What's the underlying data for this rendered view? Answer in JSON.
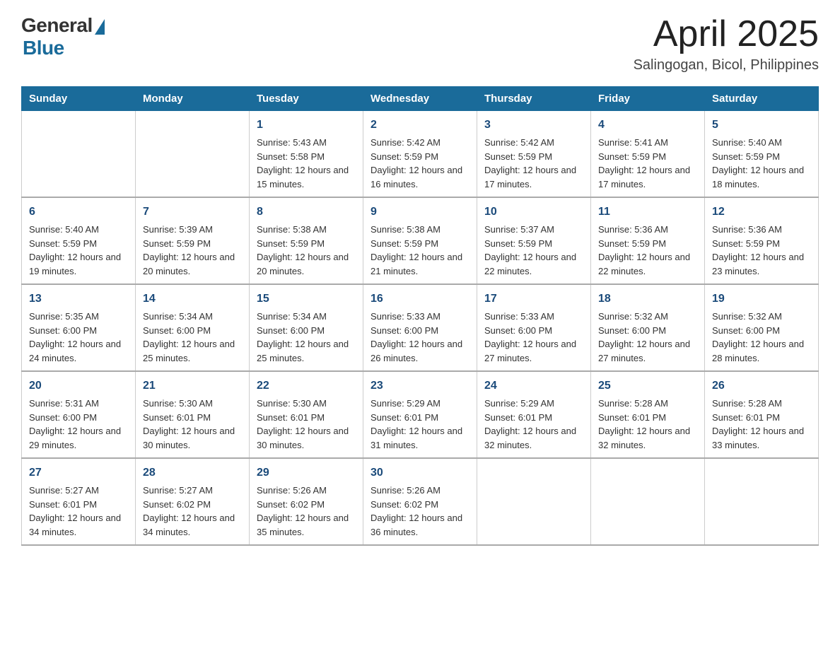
{
  "header": {
    "logo": {
      "general": "General",
      "blue": "Blue"
    },
    "title": "April 2025",
    "subtitle": "Salingogan, Bicol, Philippines"
  },
  "days_of_week": [
    "Sunday",
    "Monday",
    "Tuesday",
    "Wednesday",
    "Thursday",
    "Friday",
    "Saturday"
  ],
  "weeks": [
    [
      {
        "day": "",
        "info": ""
      },
      {
        "day": "",
        "info": ""
      },
      {
        "day": "1",
        "info": "Sunrise: 5:43 AM\nSunset: 5:58 PM\nDaylight: 12 hours and 15 minutes."
      },
      {
        "day": "2",
        "info": "Sunrise: 5:42 AM\nSunset: 5:59 PM\nDaylight: 12 hours and 16 minutes."
      },
      {
        "day": "3",
        "info": "Sunrise: 5:42 AM\nSunset: 5:59 PM\nDaylight: 12 hours and 17 minutes."
      },
      {
        "day": "4",
        "info": "Sunrise: 5:41 AM\nSunset: 5:59 PM\nDaylight: 12 hours and 17 minutes."
      },
      {
        "day": "5",
        "info": "Sunrise: 5:40 AM\nSunset: 5:59 PM\nDaylight: 12 hours and 18 minutes."
      }
    ],
    [
      {
        "day": "6",
        "info": "Sunrise: 5:40 AM\nSunset: 5:59 PM\nDaylight: 12 hours and 19 minutes."
      },
      {
        "day": "7",
        "info": "Sunrise: 5:39 AM\nSunset: 5:59 PM\nDaylight: 12 hours and 20 minutes."
      },
      {
        "day": "8",
        "info": "Sunrise: 5:38 AM\nSunset: 5:59 PM\nDaylight: 12 hours and 20 minutes."
      },
      {
        "day": "9",
        "info": "Sunrise: 5:38 AM\nSunset: 5:59 PM\nDaylight: 12 hours and 21 minutes."
      },
      {
        "day": "10",
        "info": "Sunrise: 5:37 AM\nSunset: 5:59 PM\nDaylight: 12 hours and 22 minutes."
      },
      {
        "day": "11",
        "info": "Sunrise: 5:36 AM\nSunset: 5:59 PM\nDaylight: 12 hours and 22 minutes."
      },
      {
        "day": "12",
        "info": "Sunrise: 5:36 AM\nSunset: 5:59 PM\nDaylight: 12 hours and 23 minutes."
      }
    ],
    [
      {
        "day": "13",
        "info": "Sunrise: 5:35 AM\nSunset: 6:00 PM\nDaylight: 12 hours and 24 minutes."
      },
      {
        "day": "14",
        "info": "Sunrise: 5:34 AM\nSunset: 6:00 PM\nDaylight: 12 hours and 25 minutes."
      },
      {
        "day": "15",
        "info": "Sunrise: 5:34 AM\nSunset: 6:00 PM\nDaylight: 12 hours and 25 minutes."
      },
      {
        "day": "16",
        "info": "Sunrise: 5:33 AM\nSunset: 6:00 PM\nDaylight: 12 hours and 26 minutes."
      },
      {
        "day": "17",
        "info": "Sunrise: 5:33 AM\nSunset: 6:00 PM\nDaylight: 12 hours and 27 minutes."
      },
      {
        "day": "18",
        "info": "Sunrise: 5:32 AM\nSunset: 6:00 PM\nDaylight: 12 hours and 27 minutes."
      },
      {
        "day": "19",
        "info": "Sunrise: 5:32 AM\nSunset: 6:00 PM\nDaylight: 12 hours and 28 minutes."
      }
    ],
    [
      {
        "day": "20",
        "info": "Sunrise: 5:31 AM\nSunset: 6:00 PM\nDaylight: 12 hours and 29 minutes."
      },
      {
        "day": "21",
        "info": "Sunrise: 5:30 AM\nSunset: 6:01 PM\nDaylight: 12 hours and 30 minutes."
      },
      {
        "day": "22",
        "info": "Sunrise: 5:30 AM\nSunset: 6:01 PM\nDaylight: 12 hours and 30 minutes."
      },
      {
        "day": "23",
        "info": "Sunrise: 5:29 AM\nSunset: 6:01 PM\nDaylight: 12 hours and 31 minutes."
      },
      {
        "day": "24",
        "info": "Sunrise: 5:29 AM\nSunset: 6:01 PM\nDaylight: 12 hours and 32 minutes."
      },
      {
        "day": "25",
        "info": "Sunrise: 5:28 AM\nSunset: 6:01 PM\nDaylight: 12 hours and 32 minutes."
      },
      {
        "day": "26",
        "info": "Sunrise: 5:28 AM\nSunset: 6:01 PM\nDaylight: 12 hours and 33 minutes."
      }
    ],
    [
      {
        "day": "27",
        "info": "Sunrise: 5:27 AM\nSunset: 6:01 PM\nDaylight: 12 hours and 34 minutes."
      },
      {
        "day": "28",
        "info": "Sunrise: 5:27 AM\nSunset: 6:02 PM\nDaylight: 12 hours and 34 minutes."
      },
      {
        "day": "29",
        "info": "Sunrise: 5:26 AM\nSunset: 6:02 PM\nDaylight: 12 hours and 35 minutes."
      },
      {
        "day": "30",
        "info": "Sunrise: 5:26 AM\nSunset: 6:02 PM\nDaylight: 12 hours and 36 minutes."
      },
      {
        "day": "",
        "info": ""
      },
      {
        "day": "",
        "info": ""
      },
      {
        "day": "",
        "info": ""
      }
    ]
  ]
}
